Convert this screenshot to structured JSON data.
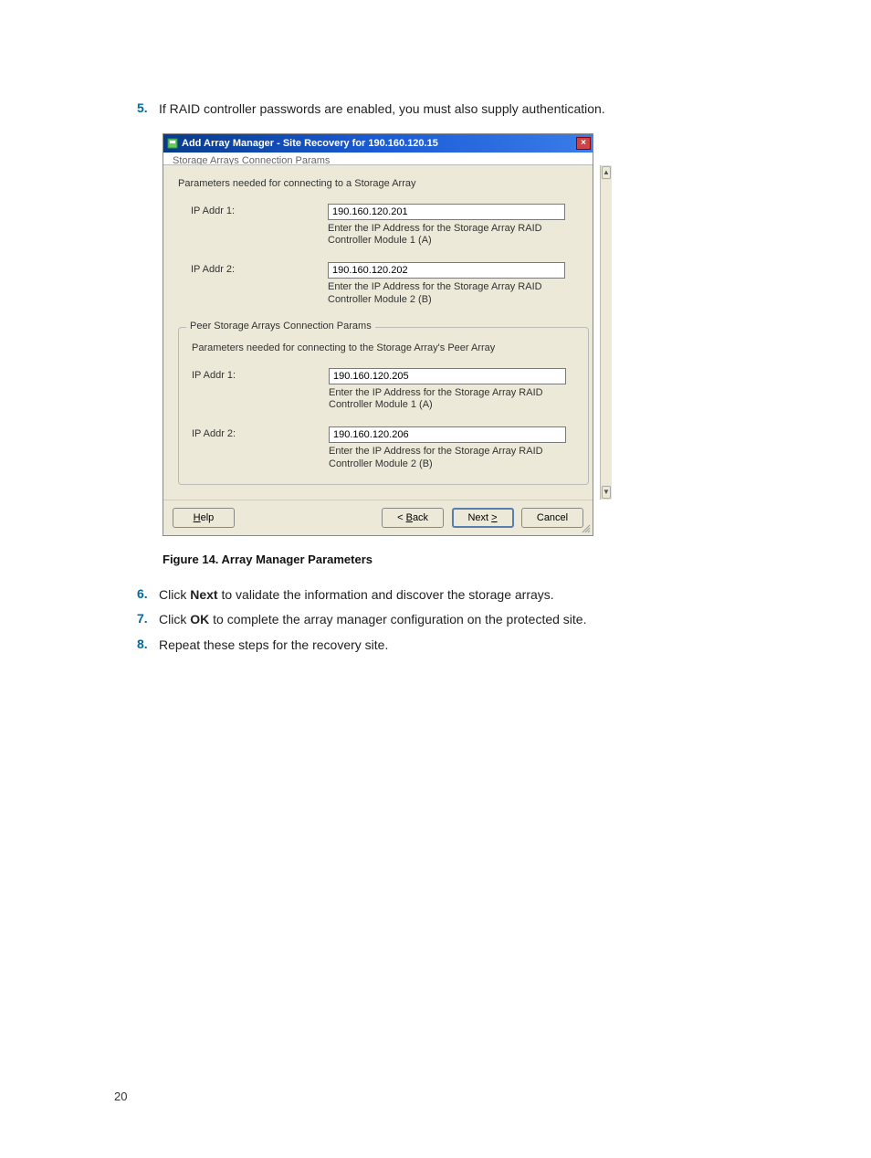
{
  "step5": {
    "num": "5.",
    "text": "If RAID controller passwords are enabled, you must also supply authentication."
  },
  "dialog": {
    "title": "Add Array Manager - Site Recovery for 190.160.120.15",
    "sub_title": "Storage Arrays Connection Params",
    "section1_text": "Parameters needed for connecting to a Storage Array",
    "help_label": "Help",
    "back_label": "< Back",
    "next_label": "Next >",
    "cancel_label": "Cancel",
    "help_u": "H",
    "back_pre": "< ",
    "back_u": "B",
    "back_post": "ack",
    "next_pre": "Next ",
    "next_u": ">",
    "s1": {
      "ip1_label": "IP Addr 1:",
      "ip1_value": "190.160.120.201",
      "ip1_hint": "Enter the IP Address for the Storage Array RAID Controller Module 1 (A)",
      "ip2_label": "IP Addr 2:",
      "ip2_value": "190.160.120.202",
      "ip2_hint": "Enter the IP Address for the Storage Array RAID Controller Module 2 (B)"
    },
    "peer_legend": "Peer Storage Arrays Connection Params",
    "section2_text": "Parameters needed for connecting to the Storage Array's Peer Array",
    "s2": {
      "ip1_label": "IP Addr 1:",
      "ip1_value": "190.160.120.205",
      "ip1_hint": "Enter the IP Address for the Storage Array RAID Controller Module 1 (A)",
      "ip2_label": "IP Addr 2:",
      "ip2_value": "190.160.120.206",
      "ip2_hint": "Enter the IP Address for the Storage Array RAID Controller Module 2 (B)"
    }
  },
  "figure_caption": "Figure 14. Array Manager Parameters",
  "step6": {
    "num": "6.",
    "pre": "Click ",
    "bold": "Next",
    "post": " to validate the information and discover the storage arrays."
  },
  "step7": {
    "num": "7.",
    "pre": "Click ",
    "bold": "OK",
    "post": " to complete the array manager configuration on the protected site."
  },
  "step8": {
    "num": "8.",
    "text": "Repeat these steps for the recovery site."
  },
  "page_number": "20"
}
